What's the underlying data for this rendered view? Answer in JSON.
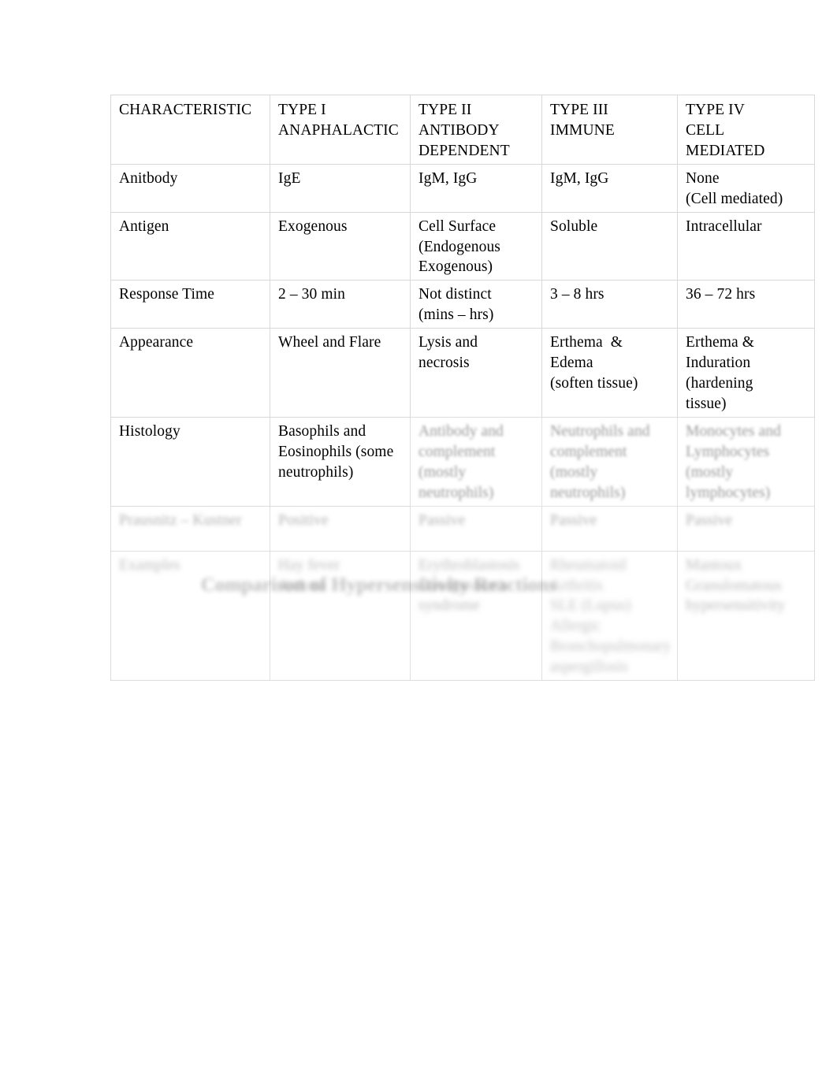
{
  "document": {
    "caption": "Comparison of Hypersensitivity Reactions"
  },
  "table": {
    "columns": [
      {
        "key": "characteristic",
        "header": "CHARACTERISTIC"
      },
      {
        "key": "type1",
        "header": "TYPE I\nANAPHALACTIC"
      },
      {
        "key": "type2",
        "header": "TYPE II\nANTIBODY\nDEPENDENT"
      },
      {
        "key": "type3",
        "header": "TYPE III\nIMMUNE"
      },
      {
        "key": "type4",
        "header": "TYPE IV\nCELL\nMEDIATED"
      }
    ],
    "rows": [
      {
        "legibility": "clear",
        "characteristic": "Anitbody",
        "type1": "IgE",
        "type2": "IgM, IgG",
        "type3": "IgM, IgG",
        "type4": "None\n(Cell mediated)"
      },
      {
        "legibility": "clear",
        "characteristic": "Antigen",
        "type1": "Exogenous",
        "type2": "Cell Surface\n(Endogenous\nExogenous)",
        "type3": "Soluble",
        "type4": "Intracellular"
      },
      {
        "legibility": "clear",
        "characteristic": "Response Time",
        "type1": "2 – 30 min",
        "type2": "Not distinct\n(mins – hrs)",
        "type3": "3 – 8 hrs",
        "type4": "36 – 72 hrs"
      },
      {
        "legibility": "clear",
        "characteristic": "Appearance",
        "type1": "Wheel and Flare",
        "type2": "Lysis and\nnecrosis",
        "type3": "Erthema  &\nEdema\n(soften tissue)",
        "type4": "Erthema &\nInduration\n(hardening\ntissue)"
      },
      {
        "legibility": "partially-legible",
        "characteristic": "Histology",
        "type1": "Basophils and\nEosinophils (some\nneutrophils)",
        "type2": "Antibody and\ncomplement\n(mostly neutrophils)",
        "type3": "Neutrophils and\ncomplement\n(mostly neutrophils)",
        "type4": "Monocytes and\nLymphocytes\n(mostly lymphocytes)"
      },
      {
        "legibility": "illegible",
        "characteristic": "Prausnitz – Kustner",
        "type1": "Positive",
        "type2": "Passive",
        "type3": "Passive",
        "type4": "Passive"
      },
      {
        "legibility": "illegible",
        "characteristic": "Examples",
        "type1": "Hay fever\nAsthma",
        "type2": "Erythroblastosis\nGoodpasture's syndrome",
        "type3": "Rheumatoid Arthritis\nSLE (Lupus)\nAllergic\nBronchopulmonary\naspergillosis",
        "type4": "Mantoux\nGranulomatous\nhypersensitivity"
      }
    ]
  }
}
